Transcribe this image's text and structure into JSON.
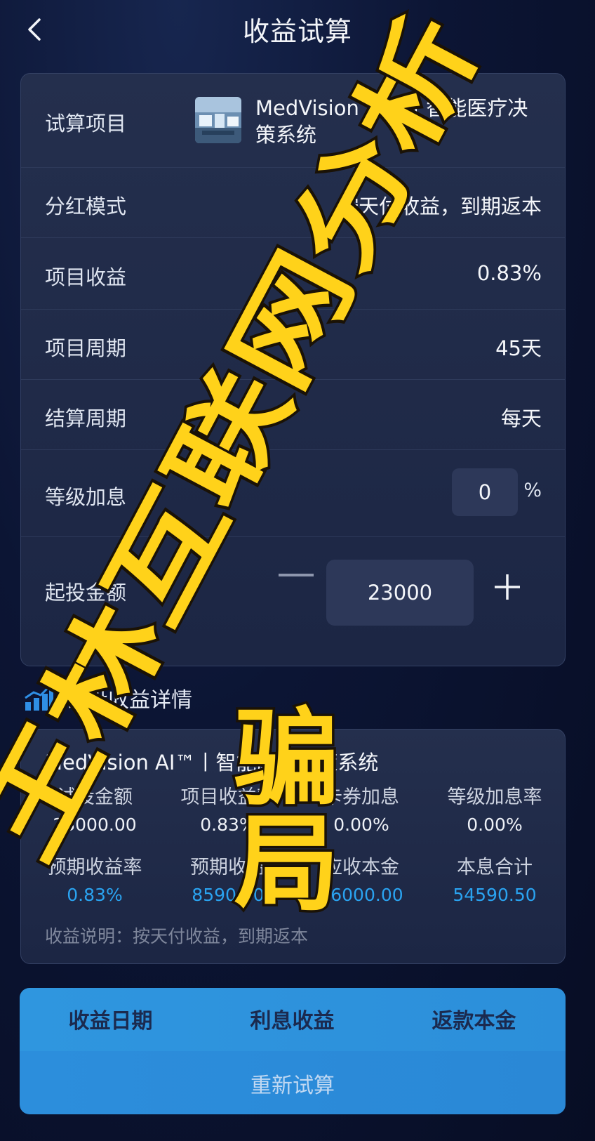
{
  "header": {
    "title": "收益试算",
    "back_icon": "chevron-left-icon"
  },
  "form": {
    "project": {
      "label": "试算项目",
      "name": "MedVision AI™丨智能医疗决策系统"
    },
    "dividend_mode": {
      "label": "分红模式",
      "value": "按天付收益，到期返本"
    },
    "project_return": {
      "label": "项目收益",
      "value": "0.83%"
    },
    "project_period": {
      "label": "项目周期",
      "value": "45天"
    },
    "settlement_period": {
      "label": "结算周期",
      "value": "每天"
    },
    "level_bonus": {
      "label": "等级加息",
      "value": "0",
      "unit": "%"
    },
    "min_investment": {
      "label": "起投金额",
      "value": "23000"
    }
  },
  "details": {
    "section_title": "试投收益详情",
    "title": "MedVision AI™丨智能医疗决策系统",
    "row1": [
      {
        "label": "试投金额",
        "value": "23000.00"
      },
      {
        "label": "项目收益率",
        "value": "0.83%"
      },
      {
        "label": "卡券加息",
        "value": "0.00%"
      },
      {
        "label": "等级加息率",
        "value": "0.00%"
      }
    ],
    "row2": [
      {
        "label": "预期收益率",
        "value": "0.83%"
      },
      {
        "label": "预期收益",
        "value": "8590.50"
      },
      {
        "label": "应收本金",
        "value": "46000.00"
      },
      {
        "label": "本息合计",
        "value": "54590.50"
      }
    ],
    "note": "收益说明：按天付收益，到期返本"
  },
  "table": {
    "columns": [
      "收益日期",
      "利息收益",
      "返款本金"
    ]
  },
  "actions": {
    "recalc_label": "重新试算"
  },
  "watermark": {
    "line1": "王林互联网分析",
    "line2": "骗局"
  },
  "colors": {
    "accent_blue": "#2aa3f0",
    "button_blue": "#2c8edc",
    "watermark_yellow": "#ffd21a"
  }
}
